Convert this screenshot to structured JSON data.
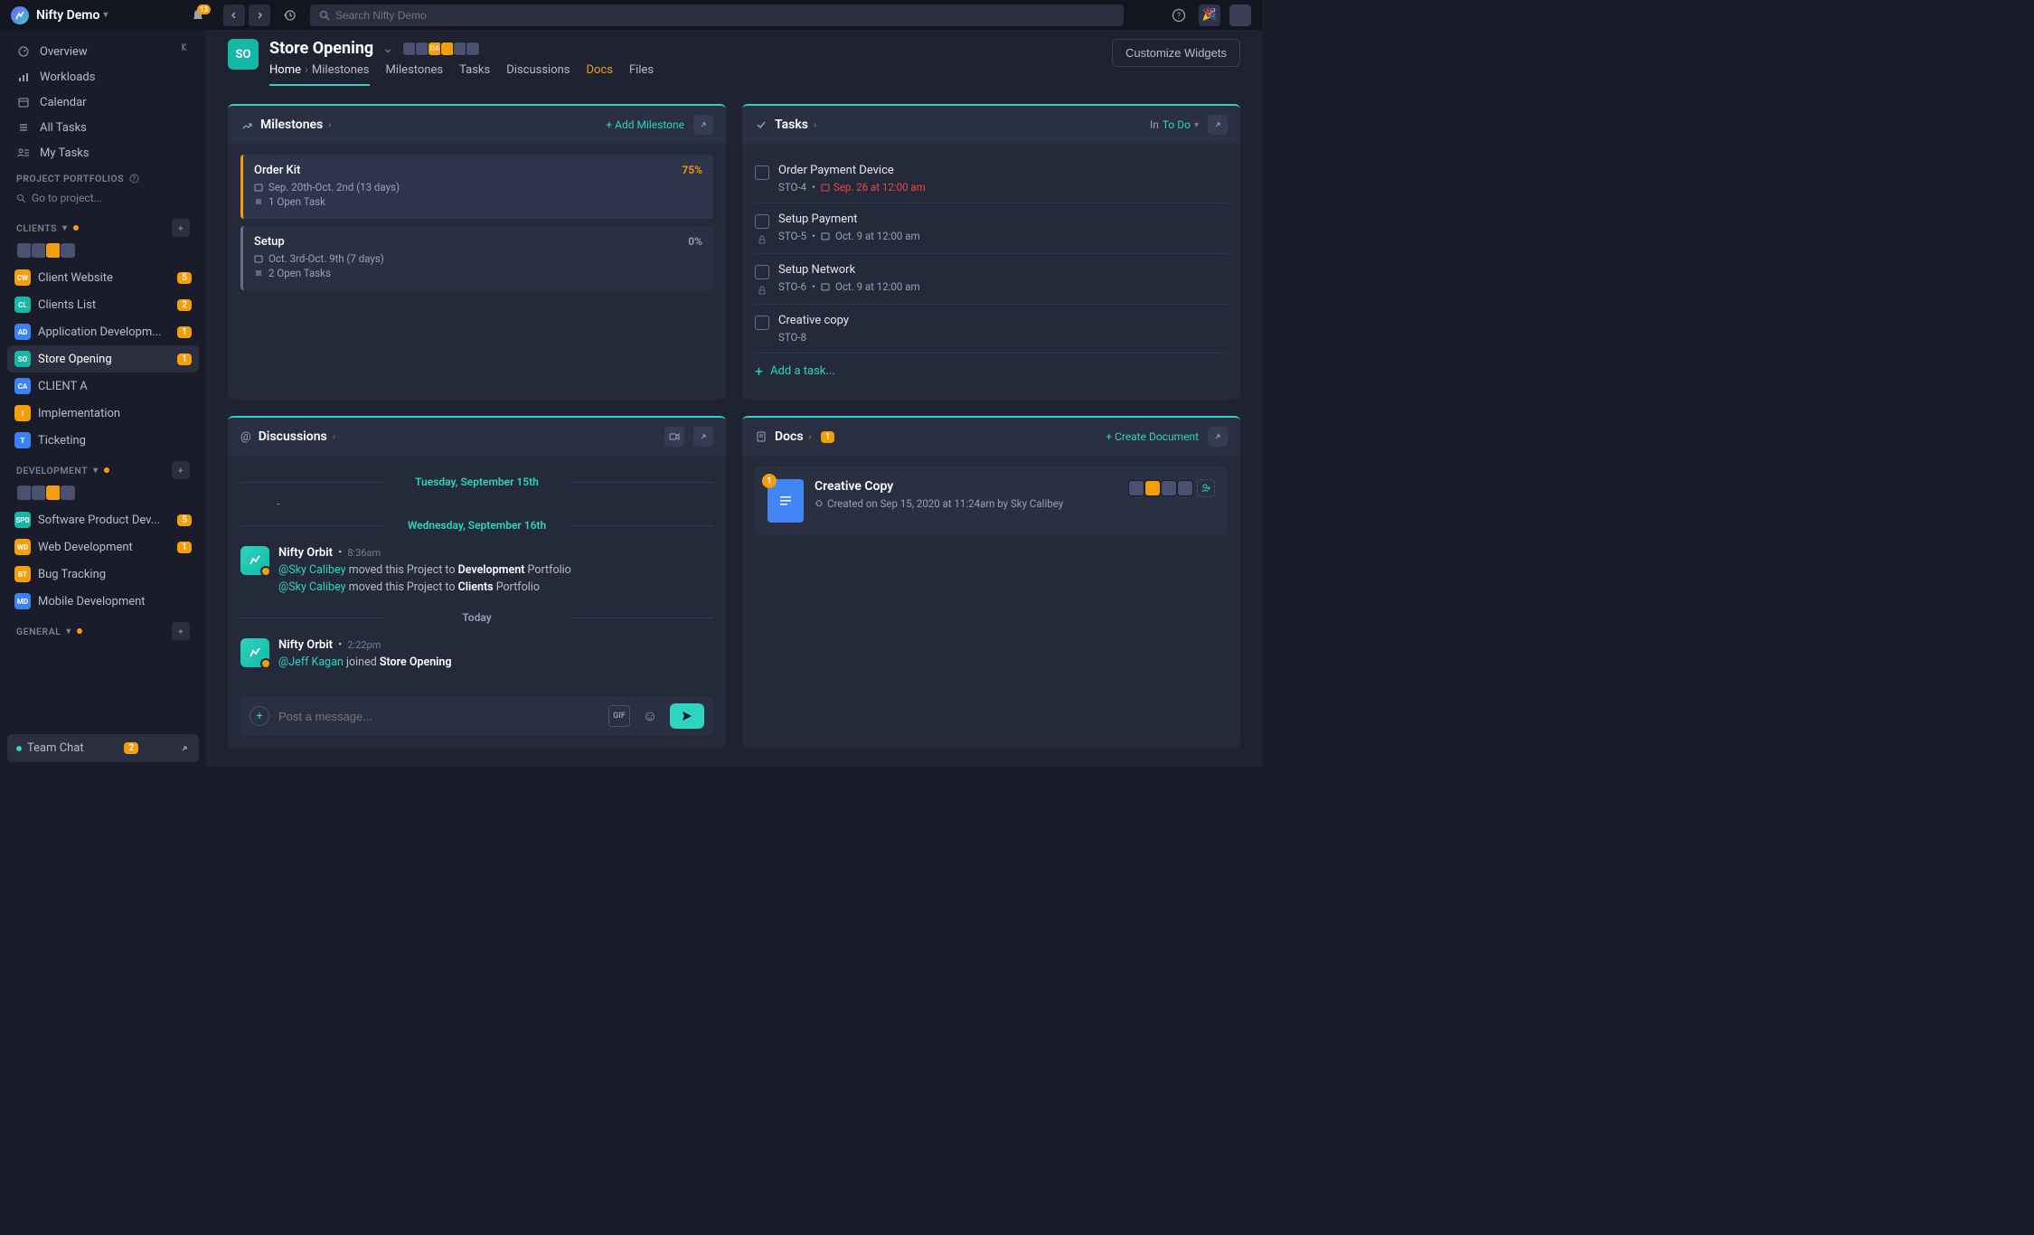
{
  "topbar": {
    "workspace": "Nifty Demo",
    "notif_count": "13",
    "search_placeholder": "Search Nifty Demo"
  },
  "customize_btn": "Customize Widgets",
  "sidebar": {
    "main": [
      {
        "label": "Overview",
        "icon": "gauge"
      },
      {
        "label": "Workloads",
        "icon": "bars"
      },
      {
        "label": "Calendar",
        "icon": "calendar"
      },
      {
        "label": "All Tasks",
        "icon": "list"
      },
      {
        "label": "My Tasks",
        "icon": "user-list"
      }
    ],
    "portfolios_label": "PROJECT PORTFOLIOS",
    "go_to_project": "Go to project...",
    "sections": [
      {
        "title": "CLIENTS",
        "has_dot": true,
        "avatars": 4,
        "projects": [
          {
            "abbr": "CW",
            "color": "#f59e0b",
            "name": "Client Website",
            "badge": "5"
          },
          {
            "abbr": "CL",
            "color": "#14b8a6",
            "name": "Clients List",
            "badge": "2"
          },
          {
            "abbr": "AD",
            "color": "#3b82f6",
            "name": "Application Developm...",
            "badge": "1"
          },
          {
            "abbr": "SO",
            "color": "#14b8a6",
            "name": "Store Opening",
            "badge": "1",
            "active": true
          },
          {
            "abbr": "CA",
            "color": "#3b82f6",
            "name": "CLIENT A"
          },
          {
            "abbr": "I",
            "color": "#f59e0b",
            "name": "Implementation"
          },
          {
            "abbr": "T",
            "color": "#3b82f6",
            "name": "Ticketing"
          }
        ]
      },
      {
        "title": "DEVELOPMENT",
        "has_dot": true,
        "avatars": 4,
        "projects": [
          {
            "abbr": "SPD",
            "color": "#14b8a6",
            "name": "Software Product Dev...",
            "badge": "5"
          },
          {
            "abbr": "WD",
            "color": "#f59e0b",
            "name": "Web Development",
            "badge": "1"
          },
          {
            "abbr": "BT",
            "color": "#f59e0b",
            "name": "Bug Tracking"
          },
          {
            "abbr": "MD",
            "color": "#3b82f6",
            "name": "Mobile Development"
          }
        ]
      },
      {
        "title": "GENERAL",
        "has_dot": true,
        "projects": []
      }
    ],
    "team_chat": {
      "label": "Team Chat",
      "count": "2"
    }
  },
  "project": {
    "abbr": "SO",
    "title": "Store Opening",
    "tabs": [
      "Home",
      "Milestones",
      "Tasks",
      "Discussions",
      "Docs",
      "Files"
    ],
    "breadcrumb_sub": "Milestones"
  },
  "milestones_panel": {
    "title": "Milestones",
    "add_label": "+ Add Milestone",
    "items": [
      {
        "name": "Order Kit",
        "dates": "Sep. 20th-Oct. 2nd (13 days)",
        "open": "1 Open Task",
        "progress": "75%",
        "color": "#f59e0b"
      },
      {
        "name": "Setup",
        "dates": "Oct. 3rd-Oct. 9th (7 days)",
        "open": "2 Open Tasks",
        "progress": "0%",
        "gray": true
      }
    ]
  },
  "tasks_panel": {
    "title": "Tasks",
    "filter_prefix": "In",
    "filter_value": "To Do",
    "add_label": "Add a task...",
    "items": [
      {
        "name": "Order Payment Device",
        "id": "STO-4",
        "date": "Sep. 26 at 12:00 am",
        "urgent": true
      },
      {
        "name": "Setup Payment",
        "id": "STO-5",
        "date": "Oct. 9 at 12:00 am",
        "locked": true
      },
      {
        "name": "Setup Network",
        "id": "STO-6",
        "date": "Oct. 9 at 12:00 am",
        "locked": true
      },
      {
        "name": "Creative copy",
        "id": "STO-8"
      }
    ]
  },
  "discussions_panel": {
    "title": "Discussions",
    "dates": [
      "Tuesday, September 15th",
      "Wednesday, September 16th",
      "Today"
    ],
    "dash": "-",
    "msgs": [
      {
        "author": "Nifty Orbit",
        "time": "8:36am",
        "lines": [
          {
            "mention": "@Sky Calibey",
            "text": " moved this Project to ",
            "strong": "Development",
            "tail": " Portfolio"
          },
          {
            "mention": "@Sky Calibey",
            "text": " moved this Project to ",
            "strong": "Clients",
            "tail": " Portfolio"
          }
        ]
      },
      {
        "author": "Nifty Orbit",
        "time": "2:22pm",
        "lines": [
          {
            "mention": "@Jeff Kagan",
            "text": " joined ",
            "strong": "Store Opening",
            "tail": ""
          }
        ]
      }
    ],
    "input_placeholder": "Post a message...",
    "gif_label": "GIF"
  },
  "docs_panel": {
    "title": "Docs",
    "count": "1",
    "create_label": "+ Create Document",
    "doc": {
      "badge": "1",
      "title": "Creative Copy",
      "meta": "Created on Sep 15, 2020 at 11:24am by Sky Calibey"
    }
  }
}
